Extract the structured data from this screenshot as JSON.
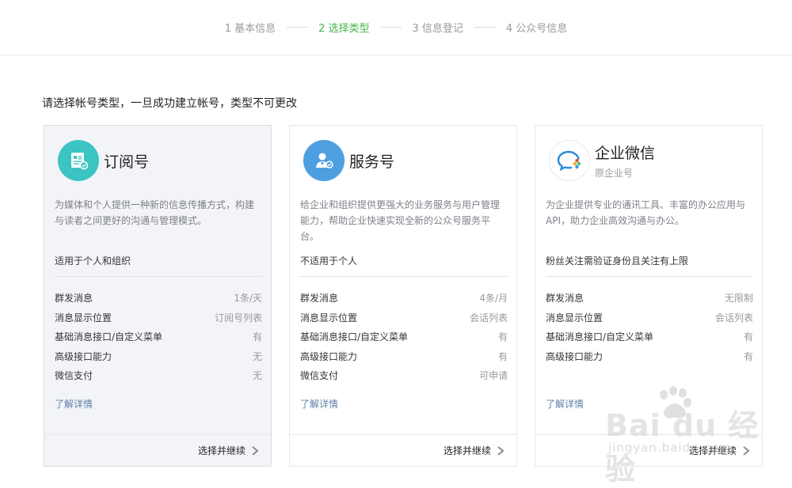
{
  "steps": [
    {
      "label": "1 基本信息"
    },
    {
      "label": "2 选择类型"
    },
    {
      "label": "3 信息登记"
    },
    {
      "label": "4 公众号信息"
    }
  ],
  "page_title": "请选择帐号类型，一旦成功建立帐号，类型不可更改",
  "cards": [
    {
      "icon": "subscription-icon",
      "name": "订阅号",
      "description": "为媒体和个人提供一种新的信息传播方式，构建与读者之间更好的沟通与管理模式。",
      "fit": "适用于个人和组织",
      "features": [
        {
          "key": "群发消息",
          "value": "1条/天"
        },
        {
          "key": "消息显示位置",
          "value": "订阅号列表"
        },
        {
          "key": "基础消息接口/自定义菜单",
          "value": "有"
        },
        {
          "key": "高级接口能力",
          "value": "无"
        },
        {
          "key": "微信支付",
          "value": "无"
        }
      ],
      "more": "了解详情",
      "action": "选择并继续"
    },
    {
      "icon": "service-account-icon",
      "name": "服务号",
      "description": "给企业和组织提供更强大的业务服务与用户管理能力，帮助企业快速实现全新的公众号服务平台。",
      "fit": "不适用于个人",
      "features": [
        {
          "key": "群发消息",
          "value": "4条/月"
        },
        {
          "key": "消息显示位置",
          "value": "会话列表"
        },
        {
          "key": "基础消息接口/自定义菜单",
          "value": "有"
        },
        {
          "key": "高级接口能力",
          "value": "有"
        },
        {
          "key": "微信支付",
          "value": "可申请"
        }
      ],
      "more": "了解详情",
      "action": "选择并继续"
    },
    {
      "icon": "wework-icon",
      "name": "企业微信",
      "subname": "原企业号",
      "description": "为企业提供专业的通讯工具、丰富的办公应用与API，助力企业高效沟通与办公。",
      "fit": "粉丝关注需验证身份且关注有上限",
      "features": [
        {
          "key": "群发消息",
          "value": "无限制"
        },
        {
          "key": "消息显示位置",
          "value": "会话列表"
        },
        {
          "key": "基础消息接口/自定义菜单",
          "value": "有"
        },
        {
          "key": "高级接口能力",
          "value": "有"
        }
      ],
      "more": "了解详情",
      "action": "选择并继续"
    }
  ],
  "watermark": {
    "brand": "Bai du 经验",
    "url": "jingyan.baidu.com"
  },
  "colors": {
    "active_step": "#44b549",
    "link": "#607fa6",
    "selected_card_bg": "#f3f4f8"
  }
}
